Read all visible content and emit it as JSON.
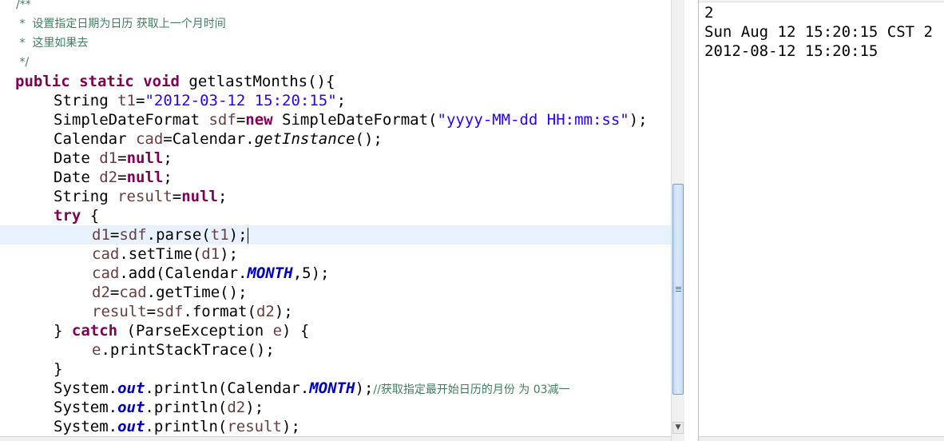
{
  "editor": {
    "comment": {
      "open": "/**",
      "line1": " *  设置指定日期为日历 获取上一个月时间",
      "line2": " *  这里如果去",
      "close": " */"
    },
    "code": {
      "kw_public": "public",
      "kw_static": "static",
      "kw_void": "void",
      "method_sig": " getlastMonths(){",
      "t_string": "String",
      "v_t1": "t1",
      "eq": "=",
      "s_date": "\"2012-03-12 15:20:15\"",
      "semi": ";",
      "t_sdf_class": "SimpleDateFormat",
      "v_sdf": "sdf",
      "kw_new": "new",
      "ctor_sdf": " SimpleDateFormat(",
      "s_pattern": "\"yyyy-MM-dd HH:mm:ss\"",
      "close_paren_semi": ");",
      "t_calendar": "Calendar",
      "v_cad": "cad",
      "calendar_dot": "Calendar.",
      "m_getinstance": "getInstance",
      "call_end": "();",
      "t_date": "Date",
      "v_d1": "d1",
      "v_d2": "d2",
      "kw_null": "null",
      "v_result": "result",
      "kw_try": "try",
      "brace_open": " {",
      "parse_call": ".parse(",
      "close_semi": ");",
      "settime_call": ".setTime(",
      "add_call": ".add(Calendar.",
      "f_month": "MONTH",
      "add_arg": ",5);",
      "gettime_call": ".getTime();",
      "format_call": ".format(",
      "brace_close": "}",
      "kw_catch": "catch",
      "catch_sig": " (ParseException ",
      "v_e": "e",
      "catch_end": ") {",
      "print_stack": ".printStackTrace();",
      "system_dot": "System.",
      "f_out": "out",
      "println_open": ".println(",
      "println_calendar": ".println(Calendar.",
      "cmt_inline": "//获取指定最开始日历的月份 为 03减一"
    }
  },
  "console": {
    "lines": [
      "2",
      "Sun Aug 12 15:20:15 CST 2",
      "2012-08-12 15:20:15"
    ]
  },
  "colors": {
    "keyword": "#7f0055",
    "string": "#2a00ff",
    "comment": "#3f7f5f",
    "static_field": "#0000c0",
    "local_var": "#6a3e3e",
    "current_line": "#e8f2fe"
  }
}
